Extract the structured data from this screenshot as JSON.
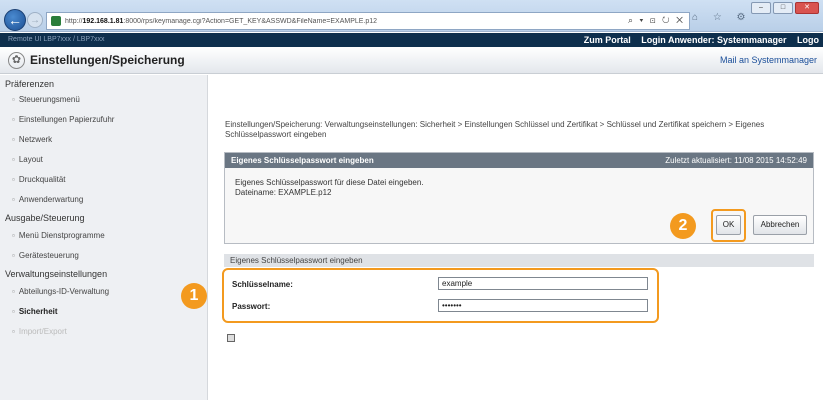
{
  "browser": {
    "url_prefix": "http://",
    "url_host": "192.168.1.81",
    "url_rest": ":8000/rps/keymanage.cgi?Action=GET_KEY&ASSWD&FileName=EXAMPLE.p12",
    "address_tools": "⌕ ▾ ⊡ ↻ ✕",
    "right_tabs": "⌂ ☆ ⚙",
    "win_min": "–",
    "win_max": "□",
    "win_close": "✕"
  },
  "topbar": {
    "left_text": "Remote UI   LBP7xxx / LBP7xxx",
    "portal": "Zum Portal",
    "login_user": "Login Anwender: Systemmanager",
    "logout": "Logo"
  },
  "header": {
    "title": "Einstellungen/Speicherung",
    "mail_link": "Mail an Systemmanager"
  },
  "sidebar": {
    "sections": [
      {
        "label": "Präferenzen",
        "items": [
          "Steuerungsmenü",
          "Einstellungen Papierzufuhr",
          "Netzwerk",
          "Layout",
          "Druckqualität",
          "Anwenderwartung"
        ]
      },
      {
        "label": "Ausgabe/Steuerung",
        "items": [
          "Menü Dienstprogramme",
          "Gerätesteuerung"
        ]
      },
      {
        "label": "Verwaltungseinstellungen",
        "items": [
          "Abteilungs-ID-Verwaltung",
          "Sicherheit",
          "Import/Export"
        ]
      }
    ]
  },
  "main": {
    "breadcrumb": "Einstellungen/Speicherung: Verwaltungseinstellungen: Sicherheit > Einstellungen Schlüssel und Zertifikat > Schlüssel und Zertifikat speichern > Eigenes Schlüsselpasswort eingeben",
    "panel": {
      "title": "Eigenes Schlüsselpasswort eingeben",
      "last_updated": "Zuletzt aktualisiert: 11/08 2015 14:52:49",
      "description": "Eigenes Schlüsselpasswort für diese Datei eingeben.",
      "filename": "Dateiname: EXAMPLE.p12",
      "ok_label": "OK",
      "cancel_label": "Abbrechen"
    },
    "form": {
      "section_title": "Eigenes Schlüsselpasswort eingeben",
      "key_name_label": "Schlüsselname:",
      "key_name_value": "example",
      "password_label": "Passwort:",
      "password_value": "•••••••"
    }
  },
  "callouts": {
    "one": "1",
    "two": "2"
  },
  "colors": {
    "accent": "#f39a1f",
    "panel_header": "#6a7683",
    "topbar": "#0e2f4d"
  }
}
